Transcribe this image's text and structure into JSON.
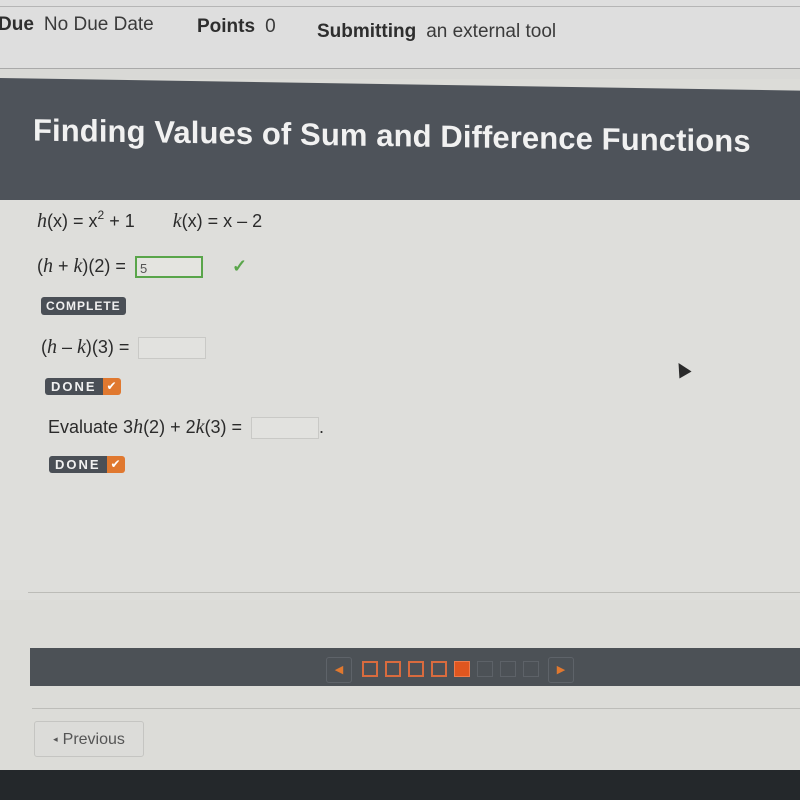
{
  "meta": {
    "due_label": "Due",
    "due_value": "No Due Date",
    "points_label": "Points",
    "points_value": "0",
    "submitting_label": "Submitting",
    "submitting_value": "an external tool"
  },
  "title": "Finding Values of Sum and Difference Functions",
  "functions": {
    "h": {
      "name": "h",
      "var": "(x) = x",
      "exp": "2",
      "rest": " + 1"
    },
    "k": {
      "name": "k",
      "var": "(x) = x – 2"
    }
  },
  "questions": [
    {
      "prefix": "(",
      "h": "h",
      "op": " + ",
      "k": "k",
      "suffix": ")(2) =",
      "answer": "5",
      "status_icon": "✓",
      "badge": "COMPLETE"
    },
    {
      "prefix": "(",
      "h": "h",
      "op": " – ",
      "k": "k",
      "suffix": ")(3) =",
      "answer": "",
      "badge": "DONE",
      "badge_icon": "✔"
    },
    {
      "lead": "Evaluate 3",
      "h": "h",
      "mid": "(2) + 2",
      "k": "k",
      "suffix": "(3) =",
      "answer": "",
      "trail": ".",
      "badge": "DONE",
      "badge_icon": "✔"
    }
  ],
  "nav": {
    "prev_icon": "◀",
    "next_icon": "▶",
    "total_steps": 8,
    "current_step": 5,
    "colors": {
      "done": "#d96b3e",
      "current": "#e0561f",
      "todo": "#5d6268"
    }
  },
  "footer": {
    "previous_label": "Previous",
    "previous_icon": "◂"
  },
  "colors": {
    "title_bg": "#4e535a",
    "accent_orange": "#e0782f",
    "correct_green": "#59a54a"
  }
}
